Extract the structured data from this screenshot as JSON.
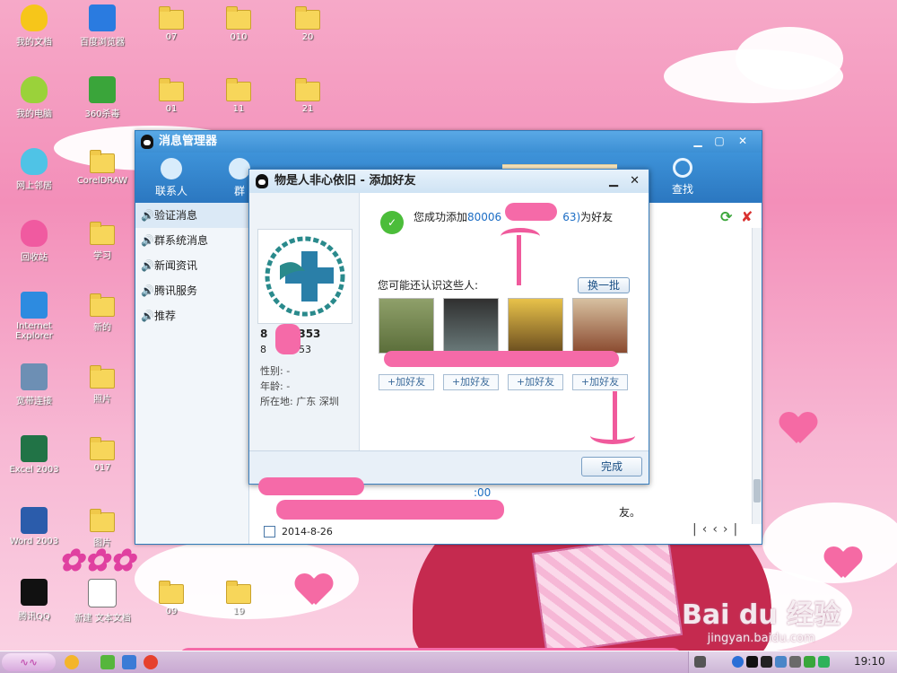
{
  "desktop": {
    "icons": [
      {
        "label": "我的文档",
        "icon": "heart-folder-icon"
      },
      {
        "label": "百度浏览器",
        "icon": "browser-icon"
      },
      {
        "label": "07",
        "icon": "folder-icon"
      },
      {
        "label": "010",
        "icon": "folder-icon"
      },
      {
        "label": "20",
        "icon": "folder-icon"
      },
      {
        "label": "我的电脑",
        "icon": "heart-computer-icon"
      },
      {
        "label": "360杀毒",
        "icon": "antivirus-icon"
      },
      {
        "label": "01",
        "icon": "folder-icon"
      },
      {
        "label": "11",
        "icon": "folder-icon"
      },
      {
        "label": "21",
        "icon": "folder-icon"
      },
      {
        "label": "网上邻居",
        "icon": "heart-network-icon"
      },
      {
        "label": "CorelDRAW",
        "icon": "folder-icon"
      },
      {
        "label": "回收站",
        "icon": "heart-recycle-icon"
      },
      {
        "label": "学习",
        "icon": "folder-icon"
      },
      {
        "label": "Internet Explorer",
        "icon": "ie-icon"
      },
      {
        "label": "新的",
        "icon": "folder-icon"
      },
      {
        "label": "宽带连接",
        "icon": "broadband-icon"
      },
      {
        "label": "照片",
        "icon": "folder-icon"
      },
      {
        "label": "Excel 2003",
        "icon": "excel-icon"
      },
      {
        "label": "017",
        "icon": "folder-icon"
      },
      {
        "label": "Word 2003",
        "icon": "word-icon"
      },
      {
        "label": "图片",
        "icon": "folder-icon"
      },
      {
        "label": "腾讯QQ",
        "icon": "qq-icon"
      },
      {
        "label": "新建 文本文档",
        "icon": "text-document-icon"
      },
      {
        "label": "09",
        "icon": "folder-icon"
      },
      {
        "label": "19",
        "icon": "folder-icon"
      }
    ]
  },
  "message_manager": {
    "title": "消息管理器",
    "toolbar": [
      {
        "label": "联系人",
        "icon": "contact-icon"
      },
      {
        "label": "群",
        "icon": "group-icon"
      },
      {
        "label": "查找",
        "icon": "search-icon"
      }
    ],
    "sidebar": [
      {
        "label": "验证消息",
        "selected": true
      },
      {
        "label": "群系统消息",
        "selected": false
      },
      {
        "label": "新闻资讯",
        "selected": false
      },
      {
        "label": "腾讯服务",
        "selected": false
      },
      {
        "label": "推荐",
        "selected": false
      }
    ],
    "message_time": ":00",
    "message_tail": "友。",
    "date": "2014-8-26"
  },
  "add_friend_dialog": {
    "title": "物是人非心依旧 - 添加好友",
    "success_prefix": "您成功添加",
    "success_id_start": "80006",
    "success_id_end": "63)",
    "success_suffix": "为好友",
    "profile": {
      "number_a": "8",
      "number_a_tail": "353",
      "number_b": "8",
      "number_b_tail": "53",
      "gender_label": "性别: -",
      "age_label": "年龄: -",
      "location_label": "所在地: 广东  深圳"
    },
    "suggest_heading": "您可能还认识这些人:",
    "refresh_label": "换一批",
    "add_friend_labels": [
      "+加好友",
      "+加好友",
      "+加好友",
      "+加好友"
    ],
    "done_label": "完成"
  },
  "taskbar": {
    "clock": "19:10"
  },
  "watermark": {
    "brand": "Bai du 经验",
    "url": "jingyan.baidu.com"
  }
}
